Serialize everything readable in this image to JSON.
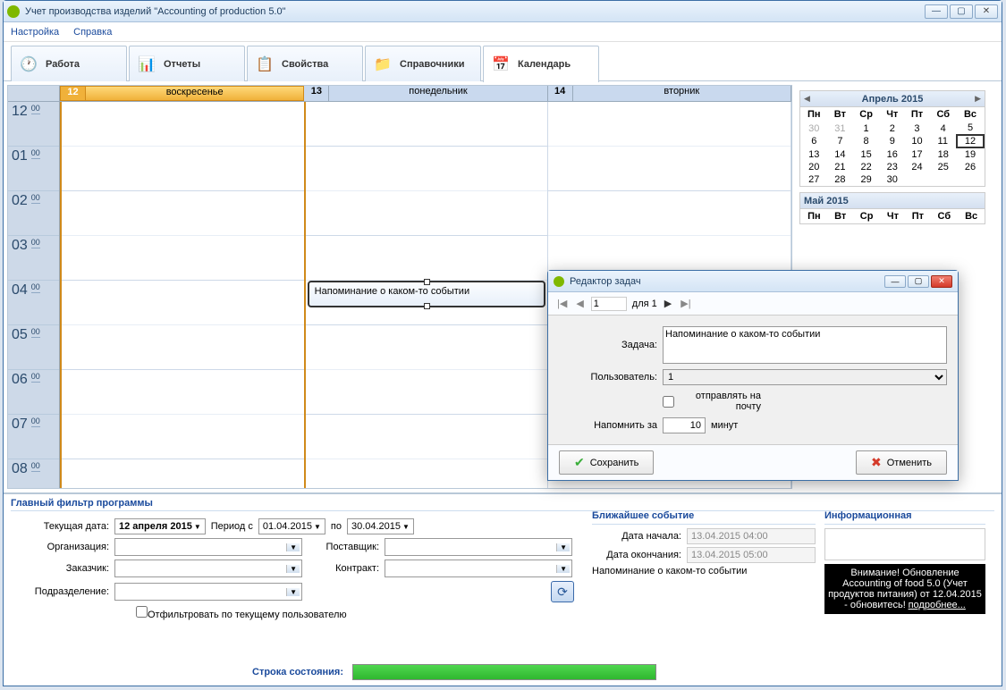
{
  "window": {
    "title": "Учет производства изделий \"Accounting of production 5.0\""
  },
  "menu": {
    "settings": "Настройка",
    "help": "Справка"
  },
  "tabs": {
    "work": "Работа",
    "reports": "Отчеты",
    "properties": "Свойства",
    "references": "Справочники",
    "calendar": "Календарь"
  },
  "calendar": {
    "days": [
      {
        "num": "12",
        "name": "воскресенье"
      },
      {
        "num": "13",
        "name": "понедельник"
      },
      {
        "num": "14",
        "name": "вторник"
      }
    ],
    "hours": [
      "12",
      "01",
      "02",
      "03",
      "04",
      "05",
      "06",
      "07",
      "08"
    ],
    "minute_label": "00",
    "event_text": "Напоминание о каком-то событии",
    "month_april": {
      "title": "Апрель 2015",
      "dow": [
        "Пн",
        "Вт",
        "Ср",
        "Чт",
        "Пт",
        "Сб",
        "Вс"
      ],
      "weeks": [
        [
          "30",
          "31",
          "1",
          "2",
          "3",
          "4",
          "5"
        ],
        [
          "6",
          "7",
          "8",
          "9",
          "10",
          "11",
          "12"
        ],
        [
          "13",
          "14",
          "15",
          "16",
          "17",
          "18",
          "19"
        ],
        [
          "20",
          "21",
          "22",
          "23",
          "24",
          "25",
          "26"
        ],
        [
          "27",
          "28",
          "29",
          "30",
          "",
          "",
          ""
        ]
      ]
    },
    "month_may": {
      "title": "Май 2015",
      "dow": [
        "Пн",
        "Вт",
        "Ср",
        "Чт",
        "Пт",
        "Сб",
        "Вс"
      ]
    }
  },
  "filter": {
    "title": "Главный фильтр программы",
    "current_date_label": "Текущая дата:",
    "current_date": "12  апреля  2015",
    "period_from_label": "Период с",
    "period_from": "01.04.2015",
    "period_to_label": "по",
    "period_to": "30.04.2015",
    "organization_label": "Организация:",
    "customer_label": "Заказчик:",
    "department_label": "Подразделение:",
    "supplier_label": "Поставщик:",
    "contract_label": "Контракт:",
    "filter_by_user": "Отфильтровать по текущему пользователю"
  },
  "nearest": {
    "title": "Ближайшее событие",
    "start_label": "Дата начала:",
    "start": "13.04.2015 04:00",
    "end_label": "Дата окончания:",
    "end": "13.04.2015 05:00",
    "text": "Напоминание о каком-то событии"
  },
  "info": {
    "title": "Информационная",
    "text": "Внимание! Обновление Accounting of food 5.0 (Учет продуктов питания) от 12.04.2015 - обновитесь!",
    "link": "подробнее..."
  },
  "status": {
    "label": "Строка состояния:"
  },
  "dialog": {
    "title": "Редактор задач",
    "nav_page": "1",
    "nav_for": "для 1",
    "task_label": "Задача:",
    "task_value": "Напоминание о каком-то событии",
    "user_label": "Пользователь:",
    "user_value": "1",
    "send_mail": "отправлять на почту",
    "remind_label": "Напомнить за",
    "remind_value": "10",
    "remind_unit": "минут",
    "save": "Сохранить",
    "cancel": "Отменить"
  }
}
